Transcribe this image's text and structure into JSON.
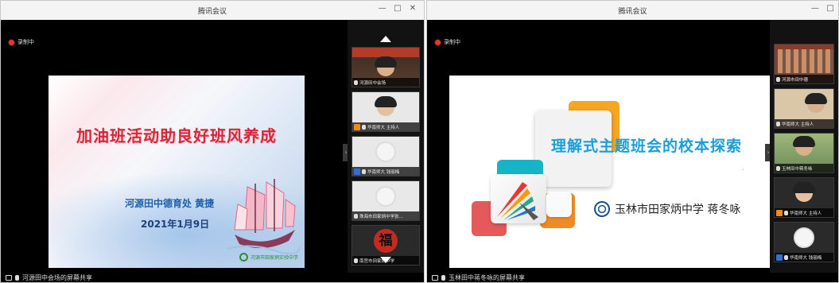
{
  "left_window": {
    "title": "腾讯会议",
    "controls": {
      "minimize": "—",
      "maximize": "□",
      "close": "✕"
    },
    "recording_label": "录制中",
    "slide": {
      "title": "加油班活动助良好班风养成",
      "author": "河源田中德育处  黄捷",
      "date": "2021年1月9日",
      "logo_text": "河源市田家炳实验中学"
    },
    "participants": [
      {
        "name": "河源田中会场",
        "role": ""
      },
      {
        "name": "华南师大 主持人",
        "role": "host"
      },
      {
        "name": "华南师大 钱丽梅",
        "role": "cohost"
      },
      {
        "name": "珠海市田家炳中学张...",
        "role": ""
      },
      {
        "name": "南宫市田家炳中学",
        "role": ""
      }
    ],
    "fu_char": "福",
    "share_label": "河源田中会场的屏幕共享"
  },
  "right_window": {
    "title": "腾讯会议",
    "controls": {
      "minimize": "—",
      "maximize": "□"
    },
    "recording_label": "录制中",
    "slide": {
      "title": "理解式主题班会的校本探索",
      "school": "玉林市田家炳中学  蒋冬咏"
    },
    "participants": [
      {
        "name": "河源市田中德",
        "role": ""
      },
      {
        "name": "华南师大 主持人",
        "role": ""
      },
      {
        "name": "玉林田中蒋冬咏",
        "role": ""
      },
      {
        "name": "华南师大 主持人",
        "role": "host"
      },
      {
        "name": "华南师大 钱丽梅",
        "role": "cohost"
      }
    ],
    "share_label": "玉林田中蒋冬咏的屏幕共享"
  },
  "colors": {
    "accent_red": "#d8263a",
    "accent_blue": "#1a9fd8",
    "recording": "#e0392f"
  }
}
